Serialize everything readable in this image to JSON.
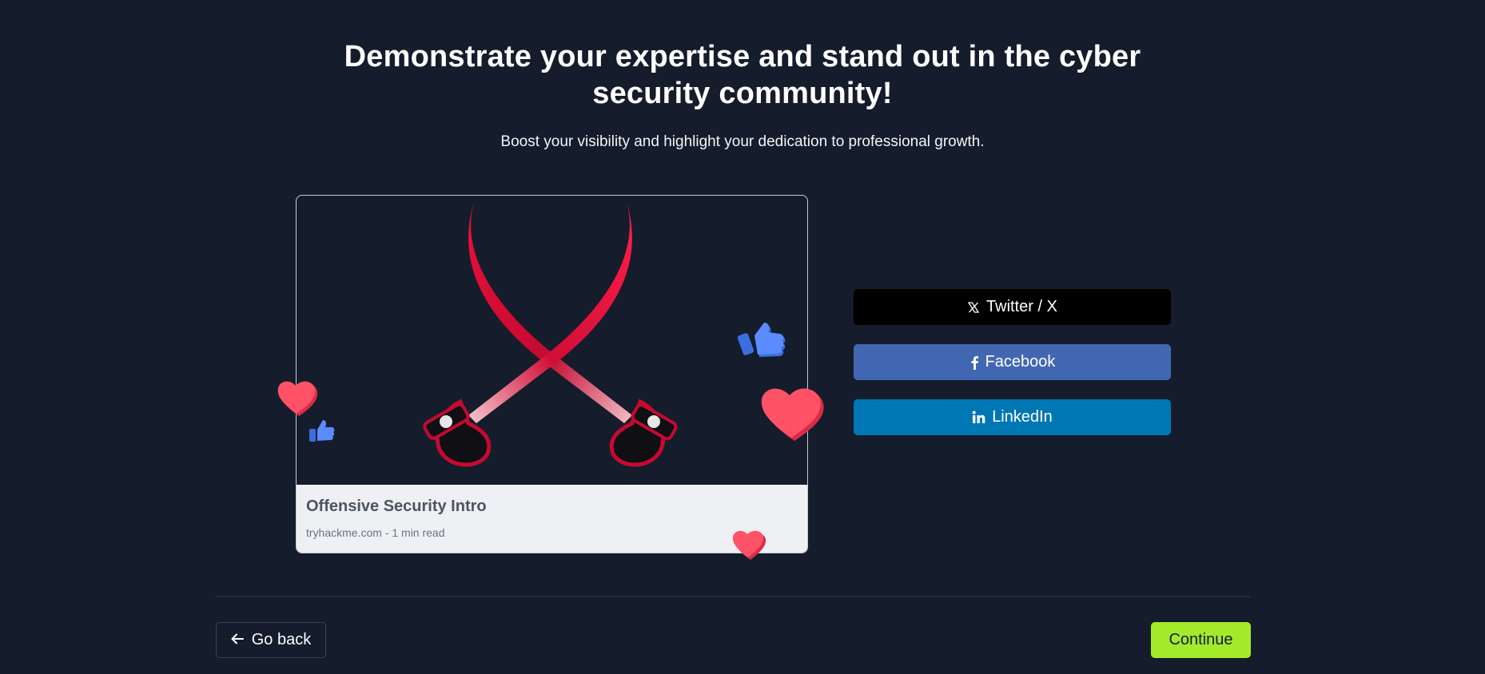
{
  "header": {
    "title_line1": "Demonstrate your expertise and stand out in the cyber",
    "title_line2": "security community!",
    "subtitle": "Boost your visibility and highlight your dedication to professional growth."
  },
  "preview_card": {
    "image_icon": "crossed-swords-illustration",
    "title": "Offensive Security Intro",
    "meta": "tryhackme.com - 1 min read"
  },
  "share": {
    "twitter_label": "Twitter / X",
    "facebook_label": "Facebook",
    "linkedin_label": "LinkedIn",
    "twitter_color": "#000000",
    "facebook_color": "#4267b2",
    "linkedin_color": "#0077b5"
  },
  "footer": {
    "back_label": "Go back",
    "continue_label": "Continue",
    "continue_color": "#a3ea2a"
  },
  "decorations": [
    "heart-icon",
    "thumbs-up-icon"
  ]
}
